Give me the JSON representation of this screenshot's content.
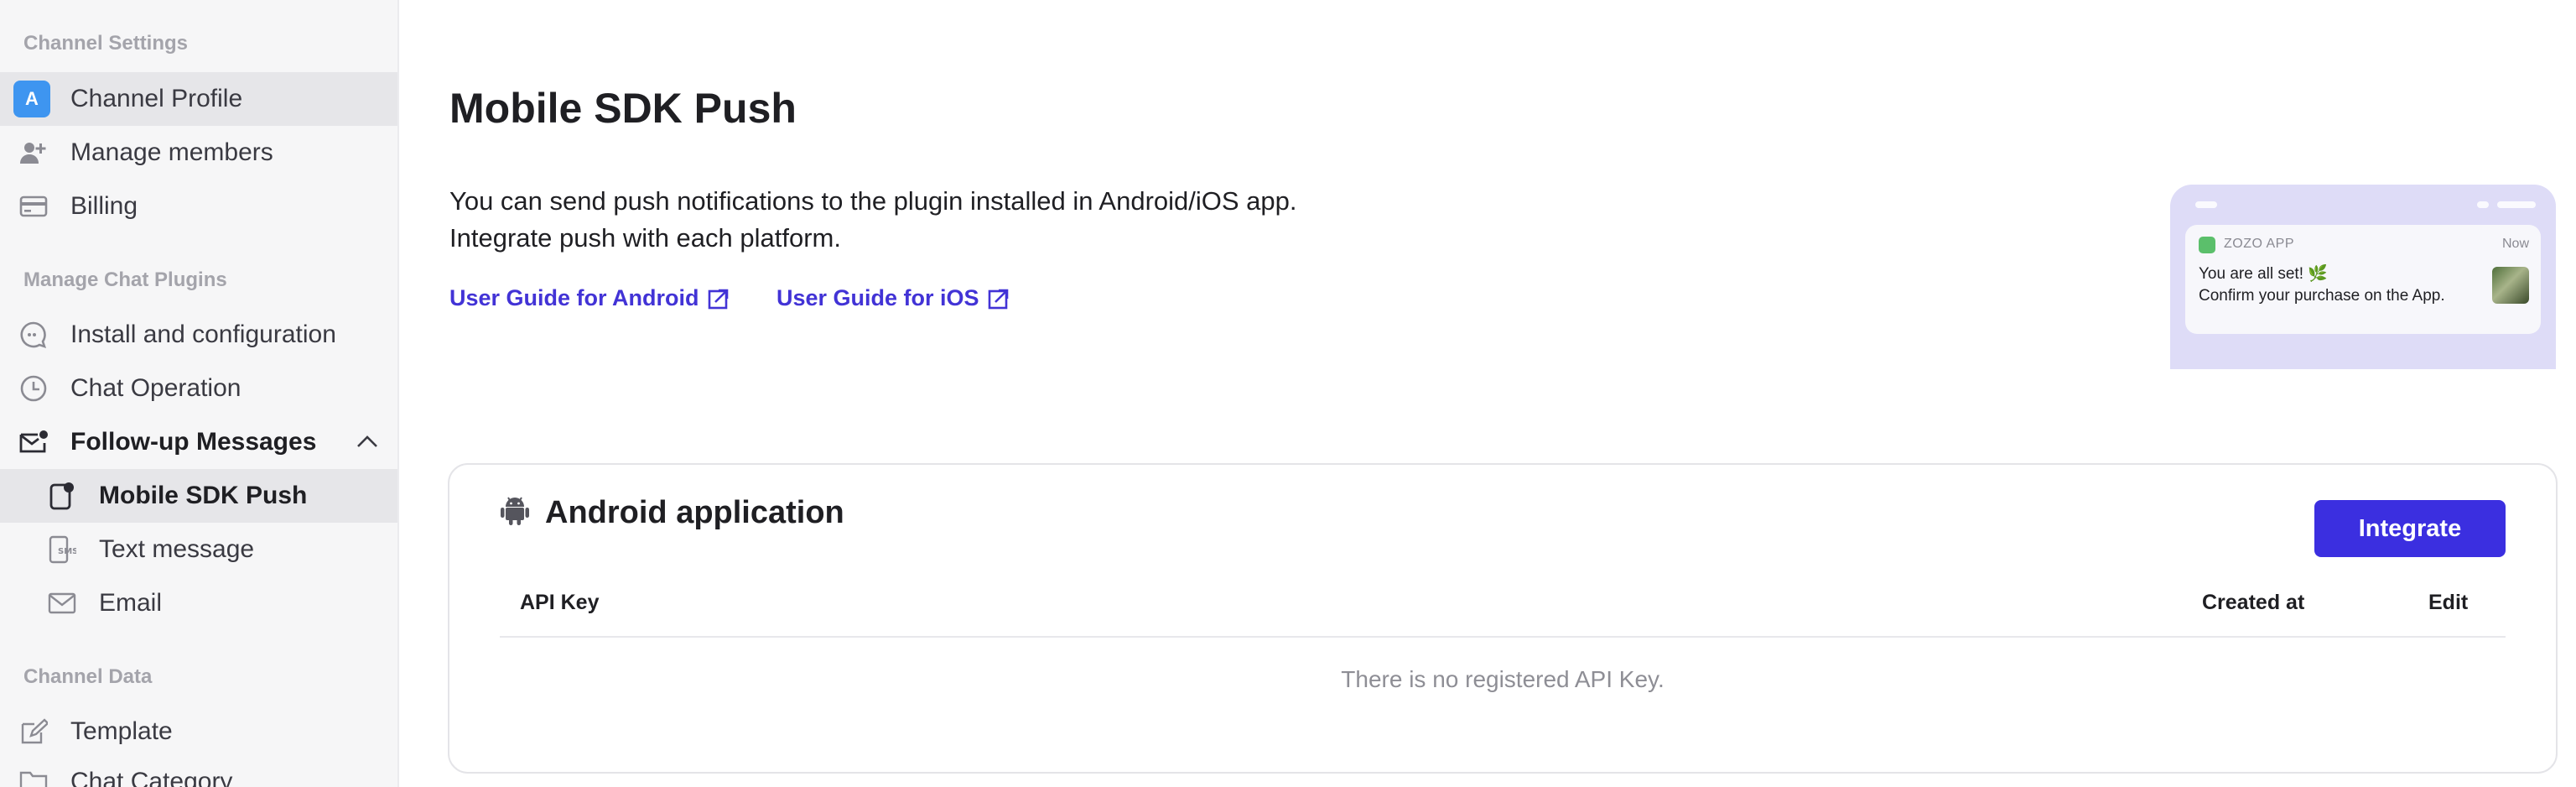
{
  "sidebar": {
    "sections": [
      {
        "title": "Channel Settings"
      },
      {
        "title": "Manage Chat Plugins"
      },
      {
        "title": "Channel Data"
      }
    ],
    "items": [
      {
        "label": "Channel Profile",
        "icon": "avatar-a-icon",
        "avatar_letter": "A"
      },
      {
        "label": "Manage members",
        "icon": "user-add-icon"
      },
      {
        "label": "Billing",
        "icon": "card-icon"
      },
      {
        "label": "Install and configuration",
        "icon": "chat-bubble-icon"
      },
      {
        "label": "Chat Operation",
        "icon": "clock-icon"
      },
      {
        "label": "Follow-up Messages",
        "icon": "mail-notify-icon"
      },
      {
        "label": "Mobile SDK Push",
        "icon": "phone-notify-icon"
      },
      {
        "label": "Text message",
        "icon": "sms-icon"
      },
      {
        "label": "Email",
        "icon": "mail-icon"
      },
      {
        "label": "Template",
        "icon": "template-icon"
      },
      {
        "label": "Chat Category",
        "icon": "folder-icon"
      }
    ]
  },
  "main": {
    "title": "Mobile SDK Push",
    "description_line1": "You can send push notifications to the plugin installed in Android/iOS app.",
    "description_line2": "Integrate push with each platform.",
    "links": [
      {
        "label": "User Guide for Android",
        "icon": "external-link-icon"
      },
      {
        "label": "User Guide for iOS",
        "icon": "external-link-icon"
      }
    ],
    "preview": {
      "app_name": "ZOZO APP",
      "time": "Now",
      "line1": "You are all set! 🌿",
      "line2": "Confirm your purchase on the App."
    },
    "card": {
      "title": "Android application",
      "icon": "android-icon",
      "button_label": "Integrate",
      "columns": [
        "API Key",
        "Created at",
        "Edit"
      ],
      "empty_text": "There is no registered API Key."
    }
  },
  "colors": {
    "accent": "#3b2fe0",
    "link": "#4233d6",
    "sidebar_bg": "#f6f6f7",
    "avatar_bg": "#3e95f0"
  }
}
